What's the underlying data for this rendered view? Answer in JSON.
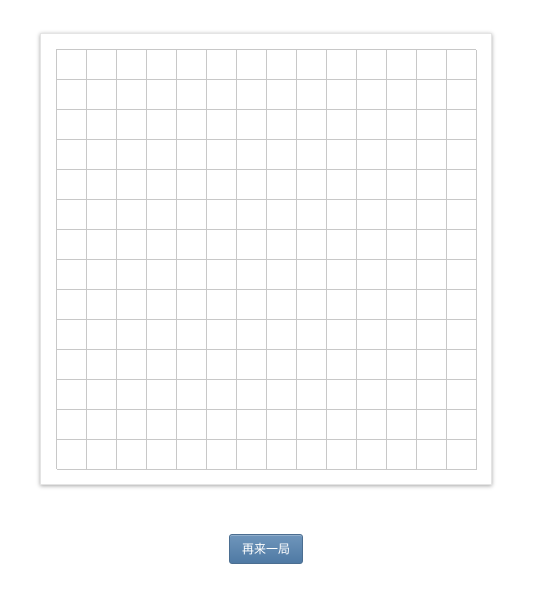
{
  "board": {
    "rows": 14,
    "cols": 14,
    "stones": []
  },
  "controls": {
    "restart_label": "再来一局"
  },
  "colors": {
    "grid_line": "#c8c8c8",
    "button_top": "#6f95bb",
    "button_bottom": "#4f7aa4"
  }
}
